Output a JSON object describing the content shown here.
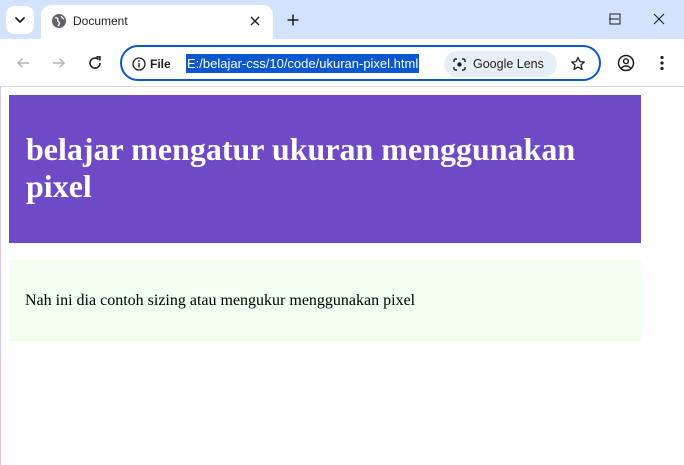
{
  "browser": {
    "tab": {
      "title": "Document"
    },
    "omnibox": {
      "site_info_label": "File",
      "url": "E:/belajar-css/10/code/ukuran-pixel.html",
      "lens_label": "Google Lens"
    }
  },
  "page": {
    "header_title": "belajar mengatur ukuran menggunakan pixel",
    "content_text": "Nah ini dia contoh sizing atau mengukur menggunakan pixel"
  },
  "colors": {
    "titlebar_bg": "#d3e3fd",
    "accent": "#0b57d0",
    "header_bg": "#6f4ac6",
    "content_bg": "#f0fff0"
  },
  "icons": [
    "chevron-down-icon",
    "globe-icon",
    "close-icon",
    "plus-icon",
    "minimize-icon",
    "maximize-icon",
    "back-arrow-icon",
    "forward-arrow-icon",
    "reload-icon",
    "info-icon",
    "lens-icon",
    "star-icon",
    "profile-icon",
    "kebab-menu-icon"
  ]
}
